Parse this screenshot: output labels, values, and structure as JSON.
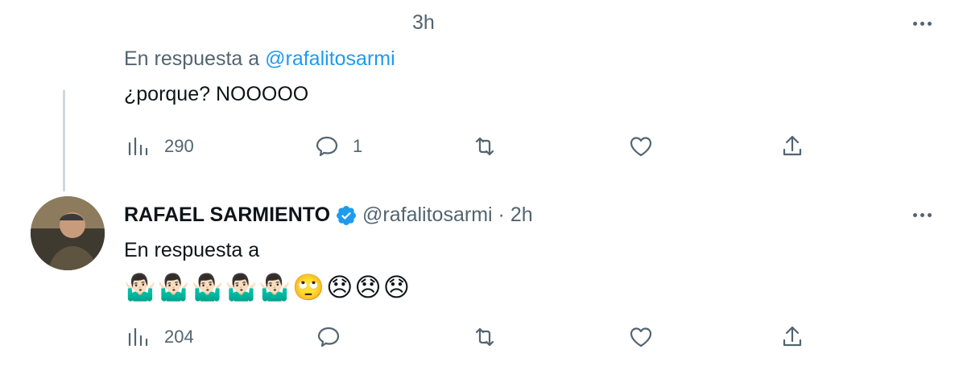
{
  "tweet1": {
    "time": "3h",
    "reply_prefix": "En respuesta a",
    "reply_handle": "@rafalitosarmi",
    "text": "¿porque? NOOOOO",
    "views": "290",
    "replies": "1"
  },
  "tweet2": {
    "name": "RAFAEL SARMIENTO",
    "handle": "@rafalitosarmi",
    "separator": "·",
    "time": "2h",
    "reply_prefix": "En respuesta a",
    "emojis": "🤷🏻‍♂️🤷🏻‍♂️🤷🏻‍♂️🤷🏻‍♂️🤷🏻‍♂️🙄😞😞😞",
    "views": "204"
  },
  "icons": {
    "views": "analytics-icon",
    "reply": "reply-icon",
    "retweet": "retweet-icon",
    "like": "heart-icon",
    "share": "share-icon",
    "more": "more-icon",
    "verified": "verified-badge-icon"
  },
  "colors": {
    "accent": "#1d9bf0",
    "muted": "#536471",
    "text": "#0f1419"
  }
}
